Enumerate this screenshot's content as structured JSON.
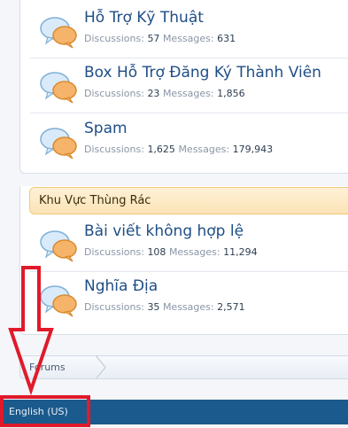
{
  "forums": [
    {
      "title": "Hỗ Trợ Kỹ Thuật",
      "discussions_label": "Discussions:",
      "discussions": "57",
      "messages_label": "Messages:",
      "messages": "631"
    },
    {
      "title": "Box Hỗ Trợ Đăng Ký Thành Viên",
      "discussions_label": "Discussions:",
      "discussions": "23",
      "messages_label": "Messages:",
      "messages": "1,856"
    },
    {
      "title": "Spam",
      "discussions_label": "Discussions:",
      "discussions": "1,625",
      "messages_label": "Messages:",
      "messages": "179,943"
    }
  ],
  "category": {
    "title": "Khu Vực Thùng Rác"
  },
  "trash_forums": [
    {
      "title": "Bài viết không hợp lệ",
      "discussions_label": "Discussions:",
      "discussions": "108",
      "messages_label": "Messages:",
      "messages": "11,294"
    },
    {
      "title": "Nghĩa Địa",
      "discussions_label": "Discussions:",
      "discussions": "35",
      "messages_label": "Messages:",
      "messages": "2,571"
    }
  ],
  "breadcrumb": {
    "forums": "Forums"
  },
  "footer": {
    "language": "English (US)"
  },
  "colors": {
    "title": "#1f4e86",
    "footer": "#1b5a8c",
    "annotation": "#e01a2a",
    "category_bg": "#fbe3b6"
  },
  "icons": {
    "forum": "speech-bubbles-icon",
    "breadcrumb_arrow": "chevron-right-icon",
    "annotation": "down-arrow-icon"
  }
}
